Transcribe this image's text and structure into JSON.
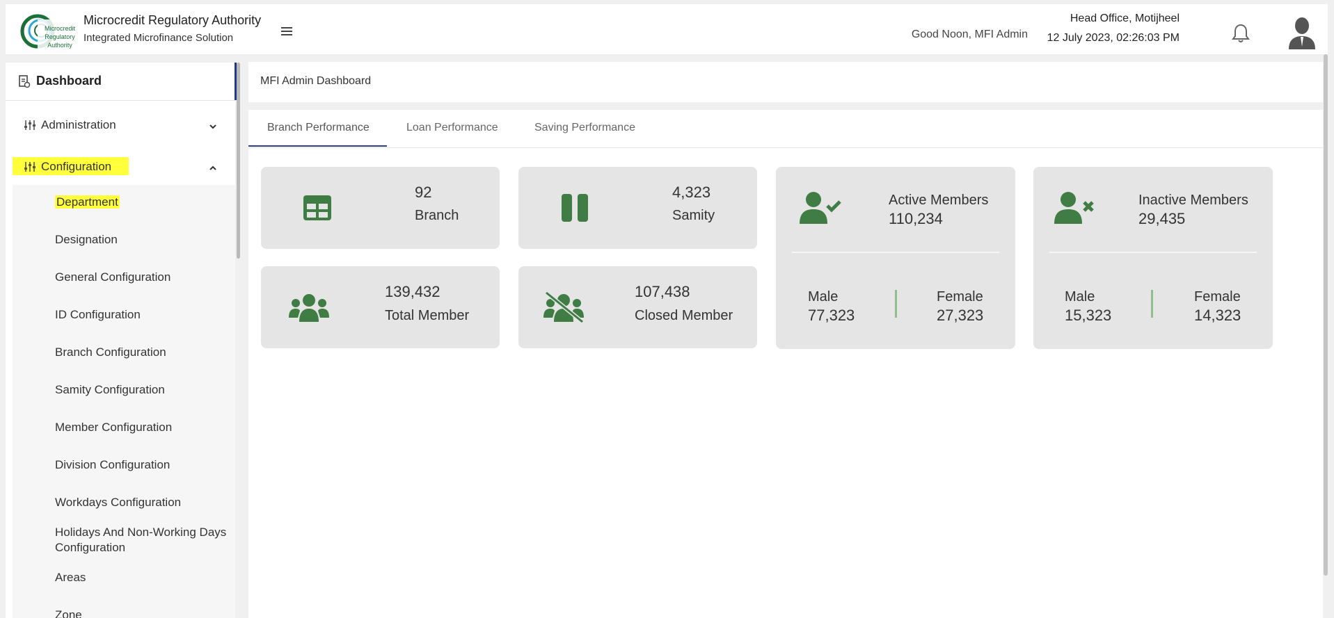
{
  "header": {
    "brand_title": "Microcredit Regulatory Authority",
    "brand_subtitle": "Integrated Microfinance Solution",
    "logo_text": [
      "Microcredit",
      "Regulatory",
      "Authority"
    ],
    "greeting": "Good Noon, MFI Admin",
    "office": "Head Office, Motijheel",
    "datetime": "12 July 2023, 02:26:03 PM"
  },
  "sidebar": {
    "dashboard": "Dashboard",
    "administration": "Administration",
    "configuration": "Configuration",
    "sub_items": [
      "Department",
      "Designation",
      "General Configuration",
      "ID Configuration",
      "Branch Configuration",
      "Samity Configuration",
      "Member Configuration",
      "Division Configuration",
      "Workdays Configuration",
      "Holidays And Non-Working Days Configuration",
      "Areas",
      "Zone"
    ]
  },
  "main": {
    "breadcrumb": "MFI Admin Dashboard",
    "tabs": [
      {
        "label": "Branch Performance",
        "active": true
      },
      {
        "label": "Loan Performance",
        "active": false
      },
      {
        "label": "Saving Performance",
        "active": false
      }
    ],
    "cards": {
      "branch": {
        "value": "92",
        "label": "Branch"
      },
      "samity": {
        "value": "4,323",
        "label": "Samity"
      },
      "total_member": {
        "value": "139,432",
        "label": "Total Member"
      },
      "closed_member": {
        "value": "107,438",
        "label": "Closed Member"
      },
      "active_members": {
        "title": "Active Members",
        "value": "110,234",
        "male_label": "Male",
        "male_value": "77,323",
        "female_label": "Female",
        "female_value": "27,323"
      },
      "inactive_members": {
        "title": "Inactive Members",
        "value": "29,435",
        "male_label": "Male",
        "male_value": "15,323",
        "female_label": "Female",
        "female_value": "14,323"
      }
    }
  },
  "colors": {
    "accent_green": "#3f7d45",
    "tab_underline": "#2c3e8c",
    "highlight": "#ffff3c",
    "card_bg": "#e4e5e4"
  }
}
